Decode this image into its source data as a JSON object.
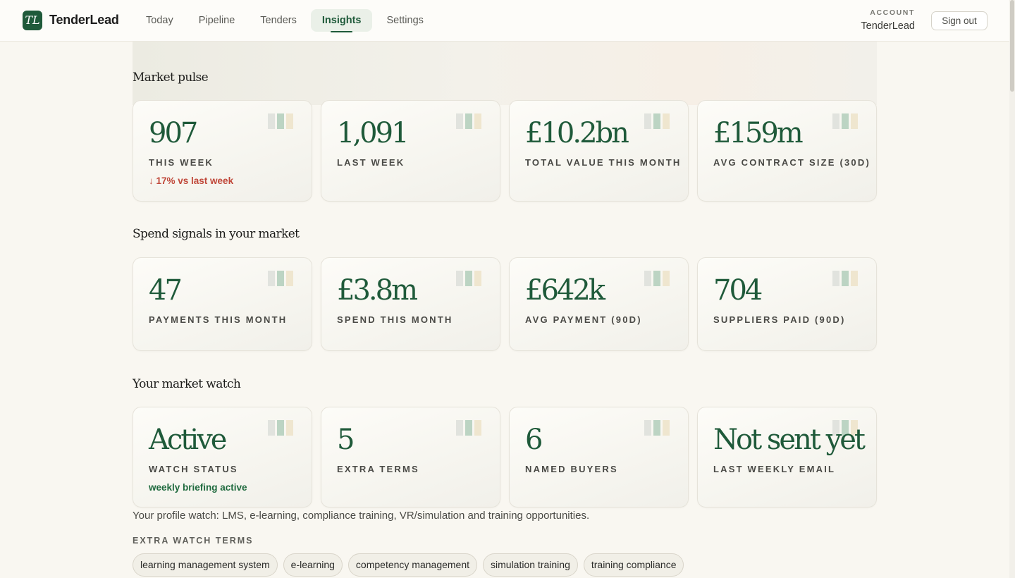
{
  "app": {
    "logo_text": "TL",
    "brand": "TenderLead"
  },
  "nav": [
    {
      "label": "Today"
    },
    {
      "label": "Pipeline"
    },
    {
      "label": "Tenders"
    },
    {
      "label": "Insights",
      "active": true
    },
    {
      "label": "Settings"
    }
  ],
  "account": {
    "label": "ACCOUNT",
    "name": "TenderLead",
    "signout": "Sign out"
  },
  "sections": {
    "market_pulse": {
      "title": "Market pulse",
      "cards": [
        {
          "value": "907",
          "label": "THIS WEEK",
          "note": "↓ 17% vs last week"
        },
        {
          "value": "1,091",
          "label": "LAST WEEK"
        },
        {
          "value": "£10.2bn",
          "label": "TOTAL VALUE THIS MONTH"
        },
        {
          "value": "£159m",
          "label": "AVG CONTRACT SIZE (30D)"
        }
      ]
    },
    "spend_signals": {
      "title": "Spend signals in your market",
      "cards": [
        {
          "value": "47",
          "label": "PAYMENTS THIS MONTH"
        },
        {
          "value": "£3.8m",
          "label": "SPEND THIS MONTH"
        },
        {
          "value": "£642k",
          "label": "AVG PAYMENT (90D)"
        },
        {
          "value": "704",
          "label": "SUPPLIERS PAID (90D)"
        }
      ]
    },
    "market_watch": {
      "title": "Your market watch",
      "cards": [
        {
          "value": "Active",
          "label": "WATCH STATUS",
          "note": "weekly briefing active"
        },
        {
          "value": "5",
          "label": "EXTRA TERMS"
        },
        {
          "value": "6",
          "label": "NAMED BUYERS"
        },
        {
          "value": "Not sent yet",
          "label": "LAST WEEKLY EMAIL"
        }
      ]
    }
  },
  "watch": {
    "profile_text": "Your profile watch: LMS, e-learning, compliance training, VR/simulation and training opportunities.",
    "terms_label": "EXTRA WATCH TERMS",
    "terms": [
      "learning management system",
      "e-learning",
      "competency management",
      "simulation training",
      "training compliance"
    ]
  },
  "colors": {
    "brand_green": "#1f5a3a",
    "negative": "#c0483a",
    "positive": "#1f6a3e",
    "background": "#f9f7f1"
  }
}
